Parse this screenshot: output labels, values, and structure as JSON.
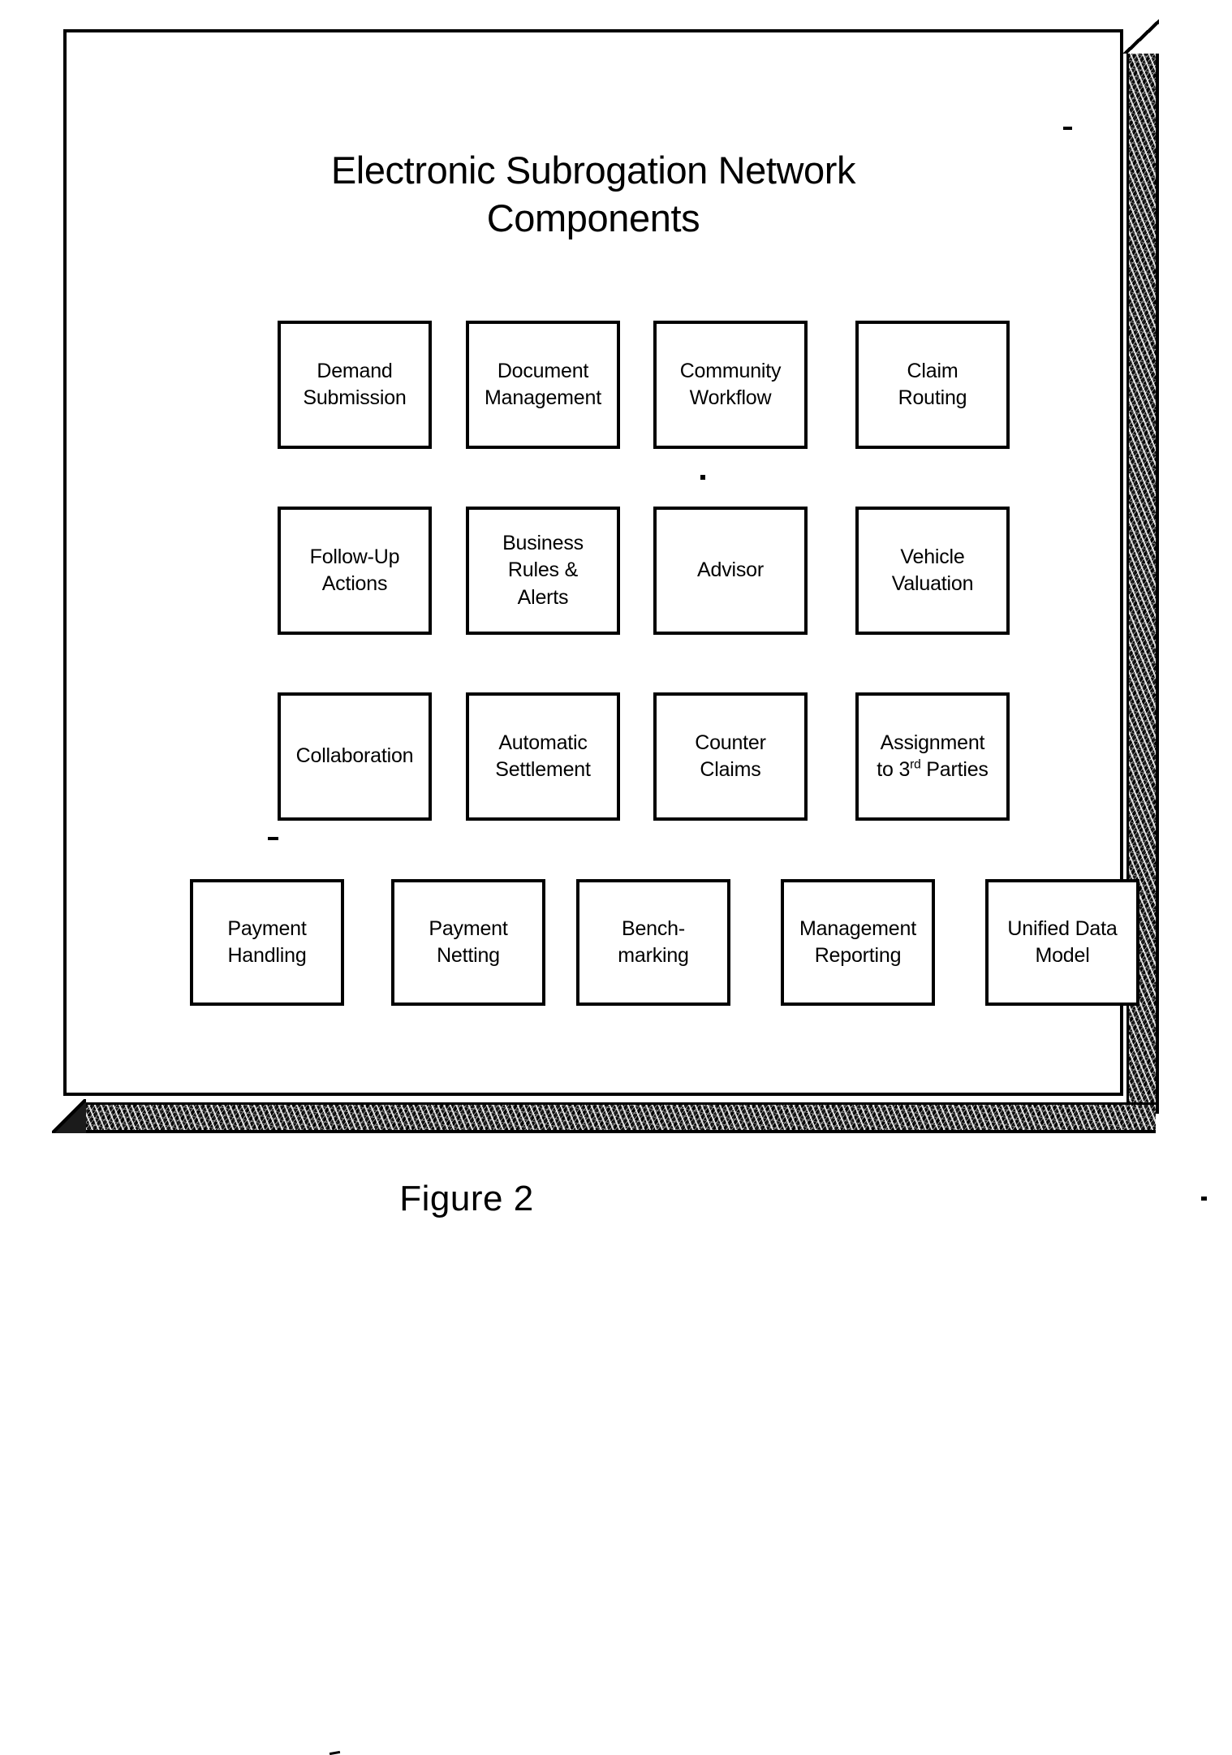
{
  "figure": {
    "caption": "Figure 2",
    "title_line_1": "Electronic Subrogation Network",
    "title_line_2": "Components"
  },
  "components": {
    "row1": [
      {
        "name": "demand-submission",
        "line1": "Demand",
        "line2": "Submission"
      },
      {
        "name": "document-management",
        "line1": "Document",
        "line2": "Management"
      },
      {
        "name": "community-workflow",
        "line1": "Community",
        "line2": "Workflow"
      },
      {
        "name": "claim-routing",
        "line1": "Claim",
        "line2": "Routing"
      }
    ],
    "row2": [
      {
        "name": "follow-up-actions",
        "line1": "Follow-Up",
        "line2": "Actions"
      },
      {
        "name": "business-rules-alerts",
        "line1": "Business",
        "line2": "Rules &",
        "line3": "Alerts"
      },
      {
        "name": "advisor",
        "line1": "Advisor"
      },
      {
        "name": "vehicle-valuation",
        "line1": "Vehicle",
        "line2": "Valuation"
      }
    ],
    "row3": [
      {
        "name": "collaboration",
        "line1": "Collaboration"
      },
      {
        "name": "automatic-settlement",
        "line1": "Automatic",
        "line2": "Settlement"
      },
      {
        "name": "counter-claims",
        "line1": "Counter",
        "line2": "Claims"
      },
      {
        "name": "assignment-to-third-parties",
        "line1": "Assignment",
        "line2_pre": "to 3",
        "line2_sup": "rd",
        "line2_post": " Parties"
      }
    ],
    "row4": [
      {
        "name": "payment-handling",
        "line1": "Payment",
        "line2": "Handling"
      },
      {
        "name": "payment-netting",
        "line1": "Payment",
        "line2": "Netting"
      },
      {
        "name": "benchmarking",
        "line1": "Bench-",
        "line2": "marking"
      },
      {
        "name": "management-reporting",
        "line1": "Management",
        "line2": "Reporting"
      },
      {
        "name": "unified-data-model",
        "line1": "Unified Data",
        "line2": "Model"
      }
    ]
  },
  "colors": {
    "ink": "#000000",
    "paper": "#ffffff",
    "shadow": "#1b1b1b"
  }
}
